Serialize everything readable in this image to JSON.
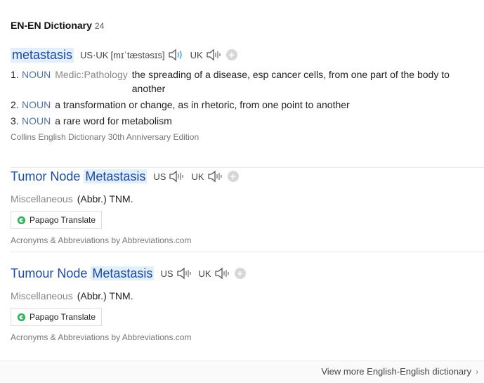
{
  "header": {
    "title": "EN-EN Dictionary",
    "count": "24"
  },
  "entry1": {
    "headword": "metastasis",
    "us_uk_label": "US·UK",
    "ipa": "[mɪˈtæstəsɪs]",
    "uk_label": "UK",
    "senses": [
      {
        "num": "1.",
        "pos": "NOUN",
        "domain": "Medic:Pathology",
        "definition": "the spreading of a disease, esp cancer cells, from one part of the body to another"
      },
      {
        "num": "2.",
        "pos": "NOUN",
        "definition": "a transformation or change, as in rhetoric, from one point to another"
      },
      {
        "num": "3.",
        "pos": "NOUN",
        "definition": "a rare word for metabolism"
      }
    ],
    "source": "Collins English Dictionary 30th Anniversary Edition"
  },
  "entry2": {
    "headword_prefix": "Tumor Node",
    "headword_match": "Metastasis",
    "us_label": "US",
    "uk_label": "UK",
    "category": "Miscellaneous",
    "abbr_text": "(Abbr.) TNM.",
    "translate_label": "Papago Translate",
    "source": "Acronyms & Abbreviations by Abbreviations.com"
  },
  "entry3": {
    "headword_prefix": "Tumour Node",
    "headword_match": "Metastasis",
    "us_label": "US",
    "uk_label": "UK",
    "category": "Miscellaneous",
    "abbr_text": "(Abbr.) TNM.",
    "translate_label": "Papago Translate",
    "source": "Acronyms & Abbreviations by Abbreviations.com"
  },
  "footer": {
    "more_label": "View more English-English dictionary"
  },
  "icons": {
    "speaker": "speaker-icon",
    "add": "plus-circle-icon",
    "papago": "papago-logo-icon",
    "chevron": "chevron-right-icon"
  },
  "colors": {
    "headword": "#1a4ba0",
    "pos": "#5473a5",
    "highlight": "#e3eefb"
  }
}
